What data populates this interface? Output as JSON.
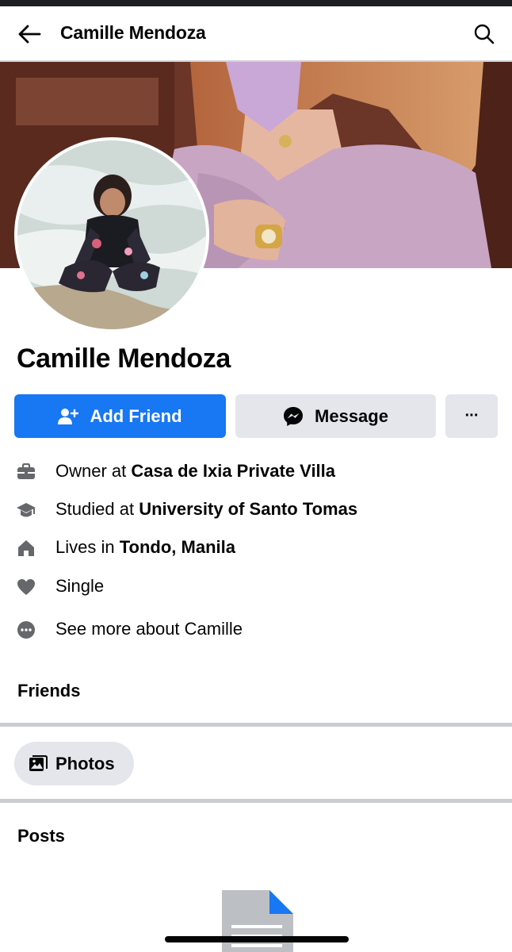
{
  "header": {
    "title": "Camille Mendoza"
  },
  "profile": {
    "name": "Camille Mendoza"
  },
  "actions": {
    "add_friend": "Add Friend",
    "message": "Message",
    "more": "···"
  },
  "details": [
    {
      "icon": "briefcase-icon",
      "prefix": "Owner at ",
      "value": "Casa de Ixia Private Villa"
    },
    {
      "icon": "graduation-cap-icon",
      "prefix": "Studied at ",
      "value": "University of Santo Tomas"
    },
    {
      "icon": "home-icon",
      "prefix": "Lives in ",
      "value": "Tondo, Manila"
    },
    {
      "icon": "heart-icon",
      "prefix": "",
      "value": "Single"
    },
    {
      "icon": "more-circle-icon",
      "prefix": "",
      "value": "See more about Camille"
    }
  ],
  "sections": {
    "friends": "Friends",
    "photos": "Photos",
    "posts": "Posts"
  },
  "colors": {
    "primary": "#1877f2",
    "secondary_button": "#e4e6eb",
    "icon_gray": "#65676b",
    "separator": "#c9ccd1"
  }
}
